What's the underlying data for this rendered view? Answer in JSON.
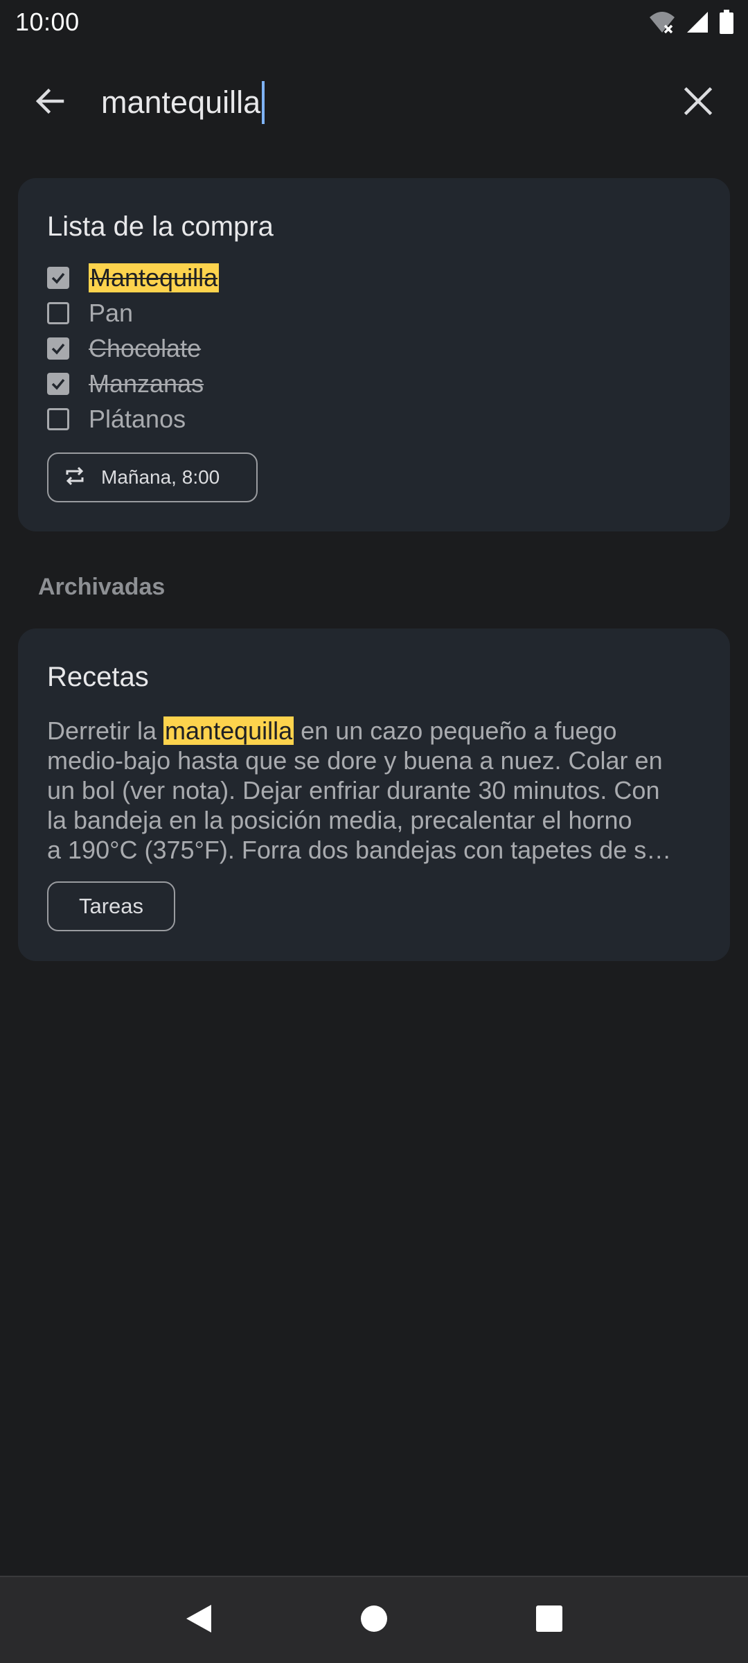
{
  "status_bar": {
    "time": "10:00"
  },
  "search": {
    "query": "mantequilla"
  },
  "notes": [
    {
      "title": "Lista de la compra",
      "items": [
        {
          "label": "Mantequilla",
          "checked": true,
          "highlighted": true
        },
        {
          "label": "Pan",
          "checked": false,
          "highlighted": false
        },
        {
          "label": "Chocolate",
          "checked": true,
          "highlighted": false
        },
        {
          "label": "Manzanas",
          "checked": true,
          "highlighted": false
        },
        {
          "label": "Plátanos",
          "checked": false,
          "highlighted": false
        }
      ],
      "reminder": "Mañana, 8:00"
    }
  ],
  "archived": {
    "header": "Archivadas",
    "note": {
      "title": "Recetas",
      "body_lines": [
        {
          "before": "Derretir la ",
          "match": "mantequilla",
          "after": " en un cazo pequeño a fuego"
        },
        {
          "text": "medio-bajo hasta que se dore y buena a nuez. Colar en"
        },
        {
          "text": "un bol (ver nota). Dejar enfriar durante 30 minutos. Con"
        },
        {
          "text": "la bandeja en la posición media, precalentar el horno"
        },
        {
          "text": "a 190°C (375°F). Forra dos bandejas con tapetes de s…"
        }
      ],
      "label": "Tareas"
    }
  },
  "icons": {
    "back": "arrow-back-icon",
    "clear": "close-icon",
    "reminder": "repeat-icon",
    "wifi": "wifi-icon",
    "signal": "signal-icon",
    "battery": "battery-icon"
  },
  "colors": {
    "background": "#1b1c1e",
    "card": "#22272e",
    "highlight": "#fdd34d",
    "caret": "#7fb3f5"
  }
}
